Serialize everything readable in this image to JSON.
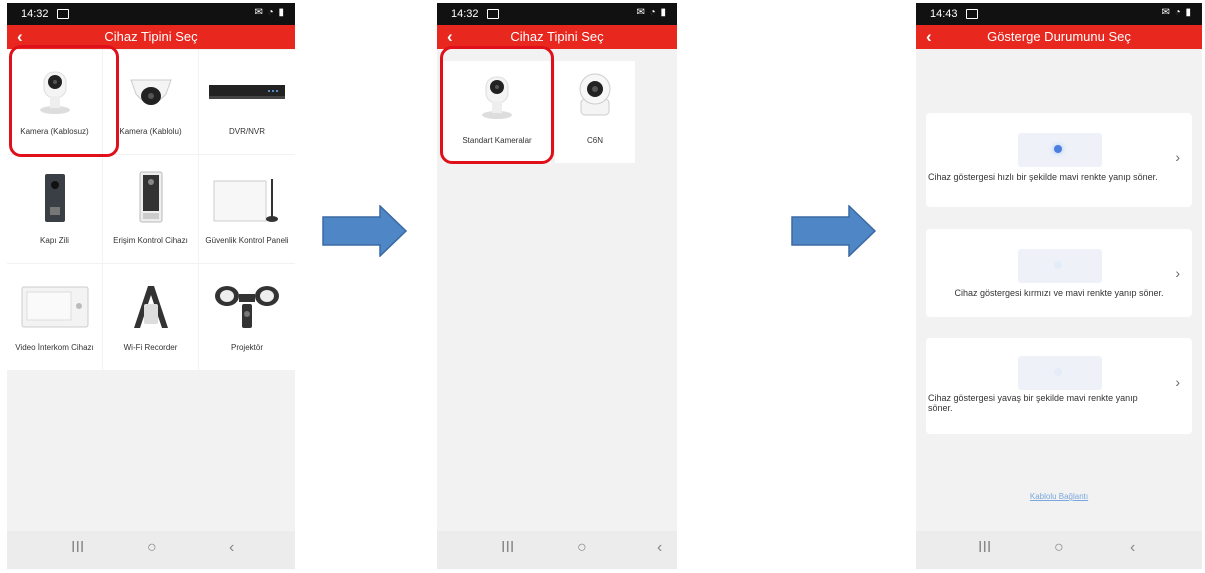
{
  "screen1": {
    "time": "14:32",
    "title": "Cihaz Tipini Seç",
    "devices": [
      {
        "label": "Kamera (Kablosuz)",
        "icon": "wireless-camera-icon"
      },
      {
        "label": "Kamera (Kablolu)",
        "icon": "dome-camera-icon"
      },
      {
        "label": "DVR/NVR",
        "icon": "dvr-icon"
      },
      {
        "label": "Kapı Zili",
        "icon": "doorbell-icon"
      },
      {
        "label": "Erişim Kontrol Cihazı",
        "icon": "access-control-icon"
      },
      {
        "label": "Güvenlik Kontrol Paneli",
        "icon": "security-panel-icon"
      },
      {
        "label": "Video İnterkom Cihazı",
        "icon": "video-intercom-icon"
      },
      {
        "label": "Wi-Fi Recorder",
        "icon": "wifi-recorder-icon"
      },
      {
        "label": "Projektör",
        "icon": "floodlight-icon"
      }
    ]
  },
  "screen2": {
    "time": "14:32",
    "title": "Cihaz Tipini Seç",
    "devices": [
      {
        "label": "Standart Kameralar",
        "icon": "standard-camera-icon"
      },
      {
        "label": "C6N",
        "icon": "ptz-camera-icon"
      }
    ]
  },
  "screen3": {
    "time": "14:43",
    "title": "Gösterge Durumunu Seç",
    "options": [
      {
        "text": "Cihaz göstergesi hızlı bir şekilde mavi renkte yanıp söner."
      },
      {
        "text": "Cihaz göstergesi kırmızı ve mavi renkte yanıp söner."
      },
      {
        "text": "Cihaz göstergesi yavaş bir şekilde mavi renkte yanıp söner."
      }
    ],
    "link": "Kablolu Bağlantı"
  },
  "colors": {
    "accent": "#e8281f",
    "highlight": "#e0101b",
    "arrow": "#4f86c6",
    "link": "#7aa7dd"
  },
  "nav": {
    "recents": "III",
    "home": "○",
    "back": "‹"
  }
}
